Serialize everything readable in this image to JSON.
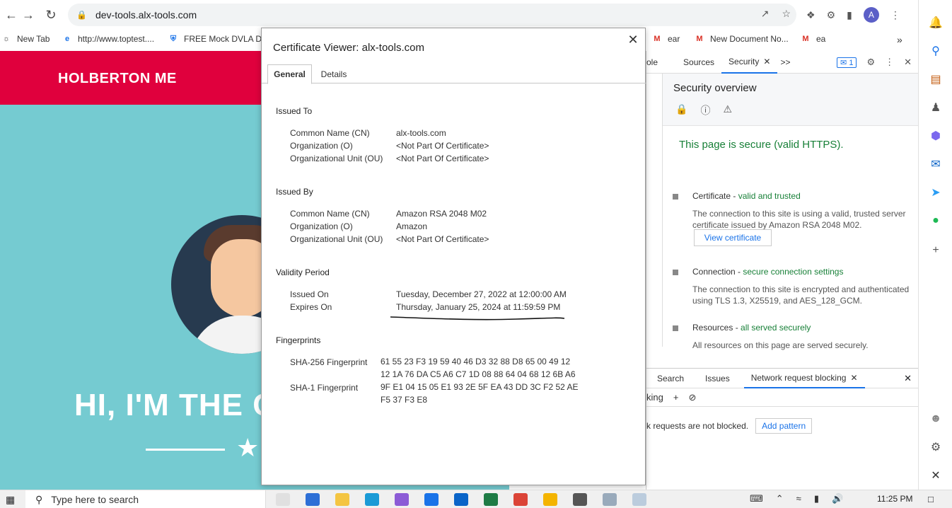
{
  "browser": {
    "url": "dev-tools.alx-tools.com",
    "bookmarks": [
      {
        "label": "New Tab",
        "icon": "globe-icon"
      },
      {
        "label": "http://www.toptest....",
        "icon": "e-icon"
      },
      {
        "label": "FREE Mock DVLA D...",
        "icon": "shield-icon"
      },
      {
        "label": "ear",
        "icon": "gmail-icon"
      },
      {
        "label": "New Document No...",
        "icon": "gmail-icon"
      },
      {
        "label": "ea",
        "icon": "gmail-icon"
      }
    ],
    "avatar_letter": "A",
    "overflow": "»"
  },
  "page": {
    "brand": "HOLBERTON ME",
    "hero": "HI, I'M THE C",
    "colors": {
      "header": "#e0003d",
      "background": "#75cbd1"
    }
  },
  "dialog": {
    "title": "Certificate Viewer: alx-tools.com",
    "tabs": [
      "General",
      "Details"
    ],
    "issued_to": {
      "heading": "Issued To",
      "rows": [
        {
          "k": "Common Name (CN)",
          "v": "alx-tools.com"
        },
        {
          "k": "Organization (O)",
          "v": "<Not Part Of Certificate>"
        },
        {
          "k": "Organizational Unit (OU)",
          "v": "<Not Part Of Certificate>"
        }
      ]
    },
    "issued_by": {
      "heading": "Issued By",
      "rows": [
        {
          "k": "Common Name (CN)",
          "v": "Amazon RSA 2048 M02"
        },
        {
          "k": "Organization (O)",
          "v": "Amazon"
        },
        {
          "k": "Organizational Unit (OU)",
          "v": "<Not Part Of Certificate>"
        }
      ]
    },
    "validity": {
      "heading": "Validity Period",
      "rows": [
        {
          "k": "Issued On",
          "v": "Tuesday, December 27, 2022 at 12:00:00 AM"
        },
        {
          "k": "Expires On",
          "v": "Thursday, January 25, 2024 at 11:59:59 PM"
        }
      ]
    },
    "fingerprints": {
      "heading": "Fingerprints",
      "sha256_label": "SHA-256 Fingerprint",
      "sha256_value": "61 55 23 F3 19 59 40 46 D3 32 88 D8 65 00 49 12 12 1A 76 DA C5 A6 C7 1D 08 88 64 04 68 12 6B A6",
      "sha1_label": "SHA-1 Fingerprint",
      "sha1_value": "9F E1 04 15 05 E1 93 2E 5F EA 43 DD 3C F2 52 AE F5 37 F3 E8"
    }
  },
  "devtools": {
    "tabs": [
      "ole",
      "Sources",
      "Security"
    ],
    "more": ">>",
    "issues_count": "1",
    "security": {
      "title": "Security overview",
      "secure_msg": "This page is secure (valid HTTPS).",
      "certificate": {
        "label": "Certificate - ",
        "status": "valid and trusted",
        "desc": "The connection to this site is using a valid, trusted server certificate issued by Amazon RSA 2048 M02.",
        "button": "View certificate"
      },
      "connection": {
        "label": "Connection - ",
        "status": "secure connection settings",
        "desc": "The connection to this site is encrypted and authenticated using TLS 1.3, X25519, and AES_128_GCM."
      },
      "resources": {
        "label": "Resources - ",
        "status": "all served securely",
        "desc": "All resources on this page are served securely."
      }
    },
    "drawer": {
      "tabs": [
        "Search",
        "Issues",
        "Network request blocking"
      ],
      "toolbar_label": "king",
      "message": "k requests are not blocked.",
      "add_pattern": "Add pattern"
    }
  },
  "taskbar": {
    "search_placeholder": "Type here to search",
    "time": "11:25 PM"
  }
}
